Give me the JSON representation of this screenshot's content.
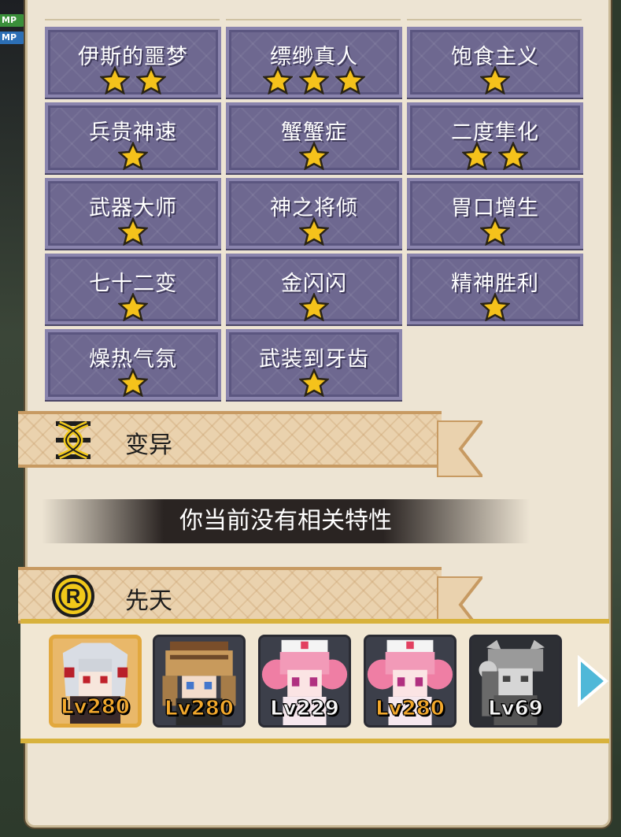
{
  "traits": [
    {
      "name": "伊斯的噩梦",
      "stars": 2
    },
    {
      "name": "缥缈真人",
      "stars": 3
    },
    {
      "name": "饱食主义",
      "stars": 1
    },
    {
      "name": "兵贵神速",
      "stars": 1
    },
    {
      "name": "蟹蟹症",
      "stars": 1
    },
    {
      "name": "二度隼化",
      "stars": 2
    },
    {
      "name": "武器大师",
      "stars": 1
    },
    {
      "name": "神之将倾",
      "stars": 1
    },
    {
      "name": "胃口增生",
      "stars": 1
    },
    {
      "name": "七十二变",
      "stars": 1
    },
    {
      "name": "金闪闪",
      "stars": 1
    },
    {
      "name": "精神胜利",
      "stars": 1
    },
    {
      "name": "燥热气氛",
      "stars": 1
    },
    {
      "name": "武装到牙齿",
      "stars": 1
    }
  ],
  "sections": {
    "mutation": {
      "label": "变异",
      "icon": "dna-icon",
      "empty_text": "你当前没有相关特性"
    },
    "innate": {
      "label": "先天",
      "icon": "r-coin-icon"
    }
  },
  "characters": [
    {
      "level": "Lv280",
      "selected": true,
      "level_color": "gold",
      "portrait": "white-haired-warrior"
    },
    {
      "level": "Lv280",
      "selected": false,
      "level_color": "gold",
      "portrait": "samurai-helmet"
    },
    {
      "level": "Lv229",
      "selected": false,
      "level_color": "white",
      "portrait": "pink-nurse"
    },
    {
      "level": "Lv280",
      "selected": false,
      "level_color": "gold",
      "portrait": "pink-nurse"
    },
    {
      "level": "Lv69",
      "selected": false,
      "level_color": "white",
      "portrait": "grey-horned"
    }
  ],
  "hud": {
    "chip1": "MP",
    "chip2": "MP"
  },
  "colors": {
    "card": "#6e6890",
    "star": "#f5c21b",
    "banner": "#ead2ae",
    "gold_border": "#d8b23c"
  }
}
